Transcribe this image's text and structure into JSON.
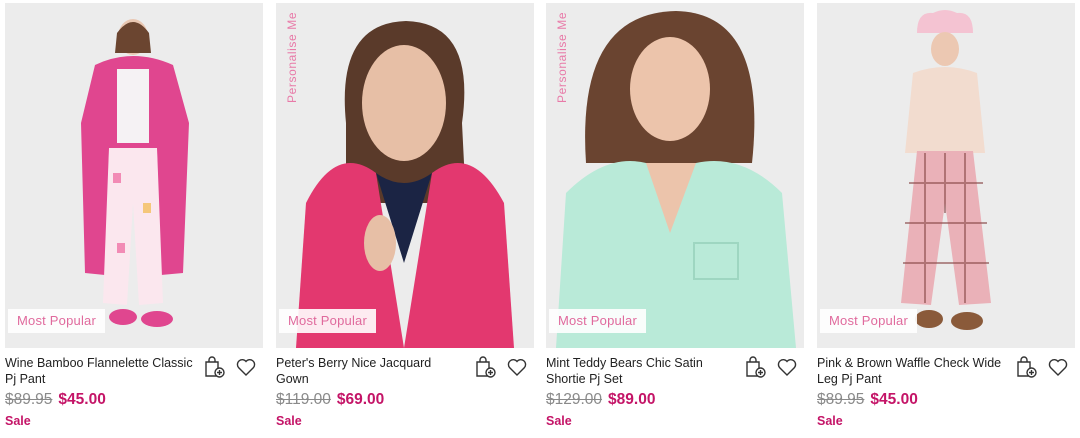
{
  "colors": {
    "accent": "#c41467",
    "badge_text": "#e06a9d",
    "strike": "#8a8a8a"
  },
  "icons": {
    "bag": "shopping-bag-add-icon",
    "wishlist": "heart-icon"
  },
  "products": [
    {
      "name": "Wine Bamboo Flannelette Classic Pj Pant",
      "was": "$89.95",
      "now": "$45.00",
      "sale": "Sale",
      "badge": "Most Popular",
      "vertical_label": ""
    },
    {
      "name": "Peter's Berry Nice Jacquard Gown",
      "was": "$119.00",
      "now": "$69.00",
      "sale": "Sale",
      "badge": "Most Popular",
      "vertical_label": "Personalise Me"
    },
    {
      "name": "Mint Teddy Bears Chic Satin Shortie Pj Set",
      "was": "$129.00",
      "now": "$89.00",
      "sale": "Sale",
      "badge": "Most Popular",
      "vertical_label": "Personalise Me"
    },
    {
      "name": "Pink & Brown Waffle Check Wide Leg Pj Pant",
      "was": "$89.95",
      "now": "$45.00",
      "sale": "Sale",
      "badge": "Most Popular",
      "vertical_label": ""
    }
  ]
}
